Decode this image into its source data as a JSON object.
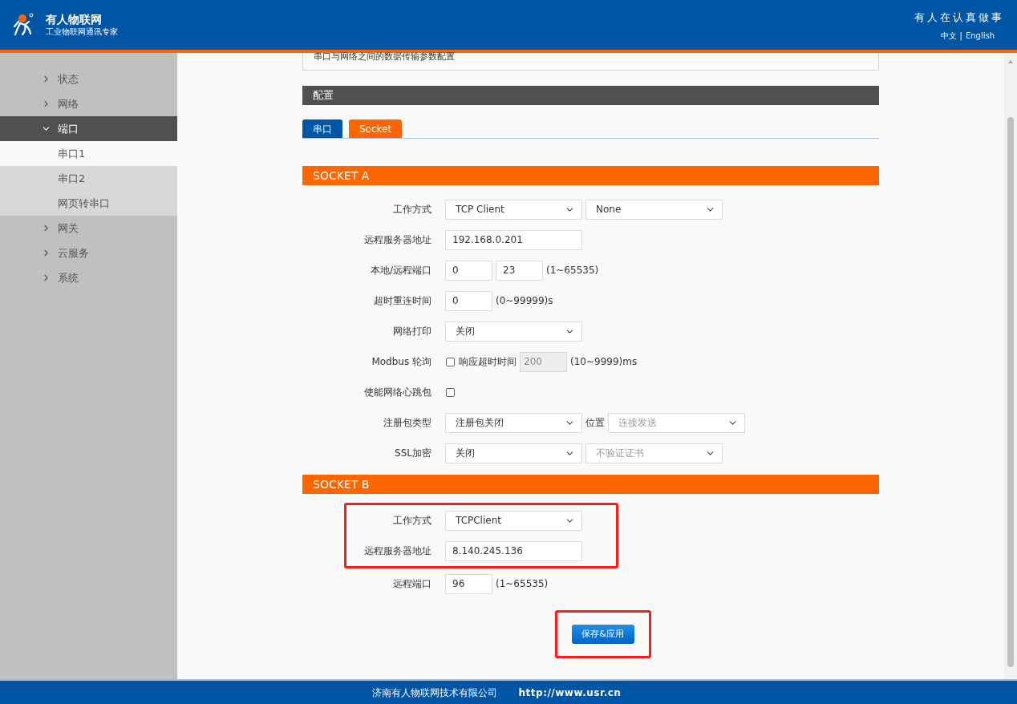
{
  "header": {
    "brand": "有人物联网",
    "tagline": "工业物联网通讯专家",
    "slogan": "有人在认真做事",
    "languages": [
      {
        "label": "中文",
        "selected": true
      },
      {
        "label": "English",
        "selected": false
      }
    ],
    "language_separator": "|"
  },
  "sidebar": {
    "items": [
      {
        "label": "状态",
        "expanded": false
      },
      {
        "label": "网络",
        "expanded": false
      },
      {
        "label": "端口",
        "expanded": true,
        "children": [
          {
            "label": "串口1",
            "selected": true
          },
          {
            "label": "串口2",
            "selected": false
          },
          {
            "label": "网页转串口",
            "selected": false
          }
        ]
      },
      {
        "label": "网关",
        "expanded": false
      },
      {
        "label": "云服务",
        "expanded": false
      },
      {
        "label": "系统",
        "expanded": false
      }
    ]
  },
  "description": "串口与网络之间的数据传输参数配置",
  "config_title": "配置",
  "tabs": [
    {
      "label": "串口",
      "selected": false
    },
    {
      "label": "Socket",
      "selected": true
    }
  ],
  "sections": [
    {
      "title": "SOCKET A",
      "rows": [
        {
          "label": "工作方式",
          "highlighted": false,
          "controls": [
            {
              "kind": "select",
              "value": "TCP Client",
              "disabled": false
            },
            {
              "kind": "select",
              "value": "None",
              "disabled": false
            }
          ]
        },
        {
          "label": "远程服务器地址",
          "highlighted": false,
          "controls": [
            {
              "kind": "input",
              "value": "192.168.0.201",
              "disabled": false
            }
          ]
        },
        {
          "label": "本地/远程端口",
          "highlighted": false,
          "controls": [
            {
              "kind": "short-input",
              "value": "0",
              "disabled": false
            },
            {
              "kind": "short-input",
              "value": "23",
              "disabled": false
            },
            {
              "kind": "text",
              "value": "(1~65535)"
            }
          ]
        },
        {
          "label": "超时重连时间",
          "highlighted": false,
          "controls": [
            {
              "kind": "short-input",
              "value": "0",
              "disabled": false
            },
            {
              "kind": "text",
              "value": "(0~99999)s"
            }
          ]
        },
        {
          "label": "网络打印",
          "highlighted": false,
          "controls": [
            {
              "kind": "select",
              "value": "关闭",
              "disabled": false
            }
          ]
        },
        {
          "label": "Modbus 轮询",
          "highlighted": false,
          "controls": [
            {
              "kind": "checkbox",
              "checked": false
            },
            {
              "kind": "text",
              "value": "响应超时时间"
            },
            {
              "kind": "short-input",
              "value": "200",
              "disabled": true
            },
            {
              "kind": "text",
              "value": "(10~9999)ms"
            }
          ]
        },
        {
          "label": "使能网络心跳包",
          "highlighted": false,
          "controls": [
            {
              "kind": "checkbox",
              "checked": false
            }
          ]
        },
        {
          "label": "注册包类型",
          "highlighted": false,
          "controls": [
            {
              "kind": "select",
              "value": "注册包关闭",
              "disabled": false
            },
            {
              "kind": "text",
              "value": "位置"
            },
            {
              "kind": "select",
              "value": "连接发送",
              "disabled": true
            }
          ]
        },
        {
          "label": "SSL加密",
          "highlighted": false,
          "controls": [
            {
              "kind": "select",
              "value": "关闭",
              "disabled": false
            },
            {
              "kind": "select",
              "value": "不验证证书",
              "disabled": true
            }
          ]
        }
      ]
    },
    {
      "title": "SOCKET B",
      "rows": [
        {
          "label": "工作方式",
          "highlighted": true,
          "controls": [
            {
              "kind": "select",
              "value": "TCPClient",
              "disabled": false
            }
          ]
        },
        {
          "label": "远程服务器地址",
          "highlighted": true,
          "controls": [
            {
              "kind": "input",
              "value": "8.140.245.136",
              "disabled": false
            }
          ]
        },
        {
          "label": "远程端口",
          "highlighted": false,
          "controls": [
            {
              "kind": "short-input",
              "value": "96",
              "disabled": false
            },
            {
              "kind": "text",
              "value": "(1~65535)"
            }
          ]
        }
      ]
    }
  ],
  "save_button": {
    "label": "保存&应用",
    "highlighted": true
  },
  "footer": {
    "company": "济南有人物联网技术有限公司",
    "url": "http://www.usr.cn"
  }
}
